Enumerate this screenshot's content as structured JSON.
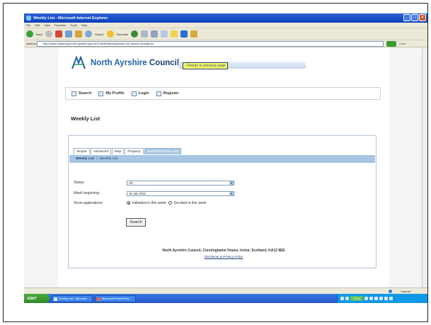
{
  "window": {
    "title": "Weekly List - Microsoft Internet Explorer"
  },
  "menubar": [
    "File",
    "Edit",
    "View",
    "Favorites",
    "Tools",
    "Help"
  ],
  "toolbar": {
    "back_label": "Back",
    "search_label": "Search",
    "favorites_label": "Favorites"
  },
  "addressbar": {
    "label": "Address",
    "url": "http://www.eplanning.north-ayrshire.gov.uk/OnlinePlanning/search.do?action=weeklyList",
    "go_label": "Go",
    "links_label": "Links"
  },
  "header": {
    "council_prefix": "North Ayrshire",
    "council_suffix": "Council",
    "return_link": "« Return to previous page"
  },
  "nav": {
    "items": [
      {
        "label": "Search"
      },
      {
        "label": "My Profile"
      },
      {
        "label": "Login"
      },
      {
        "label": "Register"
      }
    ]
  },
  "page_title": "Weekly List",
  "tabs": [
    {
      "label": "Simple",
      "active": false
    },
    {
      "label": "Advanced",
      "active": false
    },
    {
      "label": "Map",
      "active": false
    },
    {
      "label": "Property",
      "active": false
    },
    {
      "label": "Weekly/Monthly Lists",
      "active": true
    }
  ],
  "subtabs": [
    {
      "label": "Weekly List"
    },
    {
      "label": "Monthly List"
    }
  ],
  "form": {
    "status_label": "Status:",
    "status_value": "All",
    "week_label": "Week beginning:",
    "week_value": "10 Jan 2011",
    "show_label": "Show applications:",
    "radio_validated": "Validated in this week",
    "radio_decided": "Decided in this week",
    "search_button": "Search"
  },
  "footer": {
    "address": "North Ayrshire Council, Cunninghame House, Irvine, Scotland, KA12 8EE",
    "disclaimer": "Disclaimer & Privacy Policy"
  },
  "statusbar": {
    "zone": "Internet"
  },
  "taskbar": {
    "start": "start",
    "items": [
      "Weekly List - Microsof...",
      "Microsoft PowerPoint ..."
    ],
    "zoom": "100%"
  }
}
